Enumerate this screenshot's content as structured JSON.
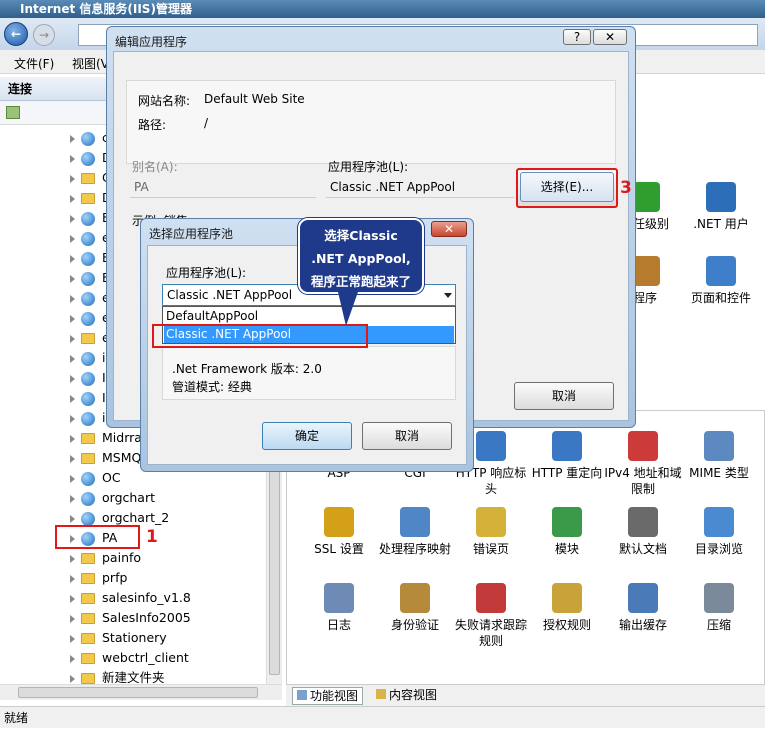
{
  "window": {
    "title": "Internet 信息服务(IIS)管理器"
  },
  "menu": {
    "file": "文件(F)",
    "view": "视图(V)"
  },
  "connections": {
    "header": "连接"
  },
  "tree": {
    "items": [
      "c",
      "D",
      "C",
      "D",
      "E",
      "e",
      "E",
      "E",
      "e",
      "e",
      "e",
      "i",
      "I",
      "I",
      "i",
      "Midrra",
      "MSMQ",
      "OC",
      "orgchart",
      "orgchart_2",
      "PA",
      "painfo",
      "prfp",
      "salesinfo_v1.8",
      "SalesInfo2005",
      "Stationery",
      "webctrl_client",
      "新建文件夹"
    ]
  },
  "features": {
    "row0": [
      {
        "label": "信任级别",
        "color": "#2f9e2f"
      },
      {
        "label": ".NET 用户",
        "color": "#2c6fb8"
      }
    ],
    "row1": [
      {
        "label": "程序",
        "color": "#b77b2d"
      },
      {
        "label": "页面和控件",
        "color": "#3f7fc9"
      }
    ],
    "row2": [
      {
        "label": "ASP",
        "color": "#8a8a8a"
      },
      {
        "label": "CGI",
        "color": "#8a8a8a"
      },
      {
        "label": "HTTP 响应标头",
        "color": "#3a78c3"
      },
      {
        "label": "HTTP 重定向",
        "color": "#3a78c3"
      },
      {
        "label": "IPv4 地址和域限制",
        "color": "#cc3a3a"
      },
      {
        "label": "MIME 类型",
        "color": "#5c8ac0"
      }
    ],
    "row3": [
      {
        "label": "SSL 设置",
        "color": "#d4a017"
      },
      {
        "label": "处理程序映射",
        "color": "#4f86c6"
      },
      {
        "label": "错误页",
        "color": "#d4b23a"
      },
      {
        "label": "模块",
        "color": "#3a9a4a"
      },
      {
        "label": "默认文档",
        "color": "#6a6a6a"
      },
      {
        "label": "目录浏览",
        "color": "#4a8ad0"
      }
    ],
    "row4": [
      {
        "label": "日志",
        "color": "#6e8bb5"
      },
      {
        "label": "身份验证",
        "color": "#b58a3a"
      },
      {
        "label": "失败请求跟踪规则",
        "color": "#c23a3a"
      },
      {
        "label": "授权规则",
        "color": "#c9a23a"
      },
      {
        "label": "输出缓存",
        "color": "#4a7ab8"
      },
      {
        "label": "压缩",
        "color": "#7a8a9a"
      }
    ]
  },
  "bottom_tabs": {
    "feature_view": "功能视图",
    "content_view": "内容视图"
  },
  "status": {
    "text": "就绪"
  },
  "edit_dialog": {
    "title": "编辑应用程序",
    "site_name_label": "网站名称:",
    "site_name_value": "Default Web Site",
    "path_label": "路径:",
    "path_value": "/",
    "alias_label": "别名(A):",
    "alias_value": "PA",
    "pool_label": "应用程序池(L):",
    "pool_value": "Classic .NET AppPool",
    "select_button": "选择(E)...",
    "example_label": "示例: 销售",
    "cancel": "取消",
    "help": "?",
    "close": "✕"
  },
  "select_dialog": {
    "title": "选择应用程序池",
    "pool_label": "应用程序池(L):",
    "selected": "Classic .NET AppPool",
    "options": [
      "DefaultAppPool",
      "Classic .NET AppPool"
    ],
    "framework": ".Net Framework 版本: 2.0",
    "pipeline": "管道模式: 经典",
    "ok": "确定",
    "cancel": "取消",
    "close": "✕"
  },
  "annotations": {
    "callout": "选择Classic .NET AppPool,程序正常跑起来了",
    "n1": "1",
    "n3": "3"
  }
}
